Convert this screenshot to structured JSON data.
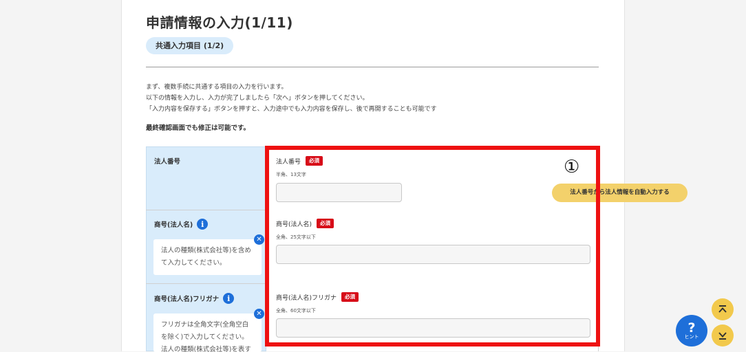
{
  "page": {
    "title": "申請情報の入力(1/11)",
    "step_pill": "共通入力項目 (1/2)",
    "intro_lines": [
      "まず、複数手続に共通する項目の入力を行います。",
      "以下の情報を入力し、入力が完了しましたら「次へ」ボタンを押してください。",
      "「入力内容を保存する」ボタンを押すと、入力途中でも入力内容を保存し、後で再開することも可能です"
    ],
    "note": "最終確認画面でも修正は可能です。"
  },
  "form": {
    "required_badge": "必須",
    "rows": [
      {
        "label": "法人番号",
        "field_label": "法人番号",
        "hint": "半角、13文字",
        "value": "",
        "button_label": "法人番号から法人情報を自動入力する"
      },
      {
        "label": "商号(法人名)",
        "tooltip": "法人の種類(株式会社等)を含めて入力してください。",
        "field_label": "商号(法人名)",
        "hint": "全角、25文字以下",
        "value": ""
      },
      {
        "label": "商号(法人名)フリガナ",
        "tooltip": "フリガナは全角文字(全角空白を除く)で入力してください。法人の種類(株式会社等)を表す",
        "field_label": "商号(法人名)フリガナ",
        "hint": "全角、60文字以下",
        "value": ""
      }
    ]
  },
  "annotation": {
    "marker": "①",
    "color": "#ee1111"
  },
  "widgets": {
    "hint_label": "ヒント",
    "hint_symbol": "?",
    "scroll_top_icon": "double-chevron-up",
    "scroll_bottom_icon": "double-chevron-down"
  },
  "colors": {
    "label_bg": "#d9ecfb",
    "required_red": "#d70c18",
    "accent_blue": "#1e6fd9",
    "button_yellow": "#f3d16b"
  }
}
